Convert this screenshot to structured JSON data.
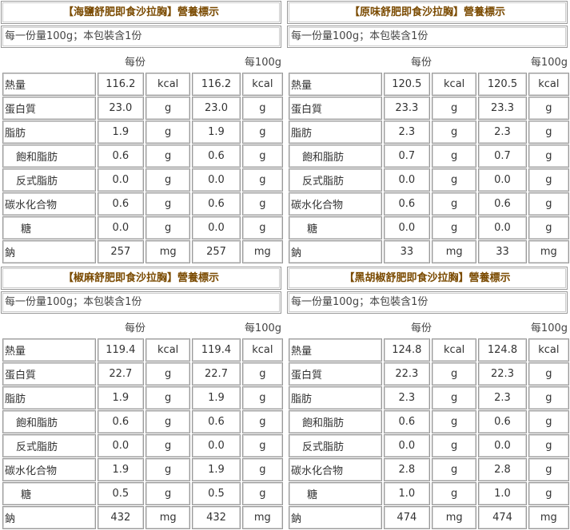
{
  "labels": {
    "per_serving": "每份",
    "per_100g": "每100g"
  },
  "panels": [
    {
      "title": "【海鹽舒肥即食沙拉胸】營養標示",
      "serving": "每一份量100g；本包裝含1份",
      "rows": [
        {
          "name": "熱量",
          "v1": "116.2",
          "u1": "kcal",
          "v2": "116.2",
          "u2": "kcal"
        },
        {
          "name": "蛋白質",
          "v1": "23.0",
          "u1": "g",
          "v2": "23.0",
          "u2": "g"
        },
        {
          "name": "脂肪",
          "v1": "1.9",
          "u1": "g",
          "v2": "1.9",
          "u2": "g"
        },
        {
          "name": "飽和脂肪",
          "v1": "0.6",
          "u1": "g",
          "v2": "0.6",
          "u2": "g"
        },
        {
          "name": "反式脂肪",
          "v1": "0.0",
          "u1": "g",
          "v2": "0.0",
          "u2": "g"
        },
        {
          "name": "碳水化合物",
          "v1": "0.6",
          "u1": "g",
          "v2": "0.6",
          "u2": "g"
        },
        {
          "name": "糖",
          "v1": "0.0",
          "u1": "g",
          "v2": "0.0",
          "u2": "g"
        },
        {
          "name": "鈉",
          "v1": "257",
          "u1": "mg",
          "v2": "257",
          "u2": "mg"
        }
      ]
    },
    {
      "title": "【原味舒肥即食沙拉胸】營養標示",
      "serving": "每一份量100g；本包裝含1份",
      "rows": [
        {
          "name": "熱量",
          "v1": "120.5",
          "u1": "kcal",
          "v2": "120.5",
          "u2": "kcal"
        },
        {
          "name": "蛋白質",
          "v1": "23.3",
          "u1": "g",
          "v2": "23.3",
          "u2": "g"
        },
        {
          "name": "脂肪",
          "v1": "2.3",
          "u1": "g",
          "v2": "2.3",
          "u2": "g"
        },
        {
          "name": "飽和脂肪",
          "v1": "0.7",
          "u1": "g",
          "v2": "0.7",
          "u2": "g"
        },
        {
          "name": "反式脂肪",
          "v1": "0.0",
          "u1": "g",
          "v2": "0.0",
          "u2": "g"
        },
        {
          "name": "碳水化合物",
          "v1": "0.6",
          "u1": "g",
          "v2": "0.6",
          "u2": "g"
        },
        {
          "name": "糖",
          "v1": "0.0",
          "u1": "g",
          "v2": "0.0",
          "u2": "g"
        },
        {
          "name": "鈉",
          "v1": "33",
          "u1": "mg",
          "v2": "33",
          "u2": "mg"
        }
      ]
    },
    {
      "title": "【椒麻舒肥即食沙拉胸】營養標示",
      "serving": "每一份量100g；本包裝含1份",
      "rows": [
        {
          "name": "熱量",
          "v1": "119.4",
          "u1": "kcal",
          "v2": "119.4",
          "u2": "kcal"
        },
        {
          "name": "蛋白質",
          "v1": "22.7",
          "u1": "g",
          "v2": "22.7",
          "u2": "g"
        },
        {
          "name": "脂肪",
          "v1": "1.9",
          "u1": "g",
          "v2": "1.9",
          "u2": "g"
        },
        {
          "name": "飽和脂肪",
          "v1": "0.6",
          "u1": "g",
          "v2": "0.6",
          "u2": "g"
        },
        {
          "name": "反式脂肪",
          "v1": "0.0",
          "u1": "g",
          "v2": "0.0",
          "u2": "g"
        },
        {
          "name": "碳水化合物",
          "v1": "1.9",
          "u1": "g",
          "v2": "1.9",
          "u2": "g"
        },
        {
          "name": "糖",
          "v1": "0.5",
          "u1": "g",
          "v2": "0.5",
          "u2": "g"
        },
        {
          "name": "鈉",
          "v1": "432",
          "u1": "mg",
          "v2": "432",
          "u2": "mg"
        }
      ]
    },
    {
      "title": "【黑胡椒舒肥即食沙拉胸】營養標示",
      "serving": "每一份量100g；本包裝含1份",
      "rows": [
        {
          "name": "熱量",
          "v1": "124.8",
          "u1": "kcal",
          "v2": "124.8",
          "u2": "kcal"
        },
        {
          "name": "蛋白質",
          "v1": "22.3",
          "u1": "g",
          "v2": "22.3",
          "u2": "g"
        },
        {
          "name": "脂肪",
          "v1": "2.3",
          "u1": "g",
          "v2": "2.3",
          "u2": "g"
        },
        {
          "name": "飽和脂肪",
          "v1": "0.6",
          "u1": "g",
          "v2": "0.6",
          "u2": "g"
        },
        {
          "name": "反式脂肪",
          "v1": "0.0",
          "u1": "g",
          "v2": "0.0",
          "u2": "g"
        },
        {
          "name": "碳水化合物",
          "v1": "2.8",
          "u1": "g",
          "v2": "2.8",
          "u2": "g"
        },
        {
          "name": "糖",
          "v1": "1.0",
          "u1": "g",
          "v2": "1.0",
          "u2": "g"
        },
        {
          "name": "鈉",
          "v1": "474",
          "u1": "mg",
          "v2": "474",
          "u2": "mg"
        }
      ]
    }
  ]
}
